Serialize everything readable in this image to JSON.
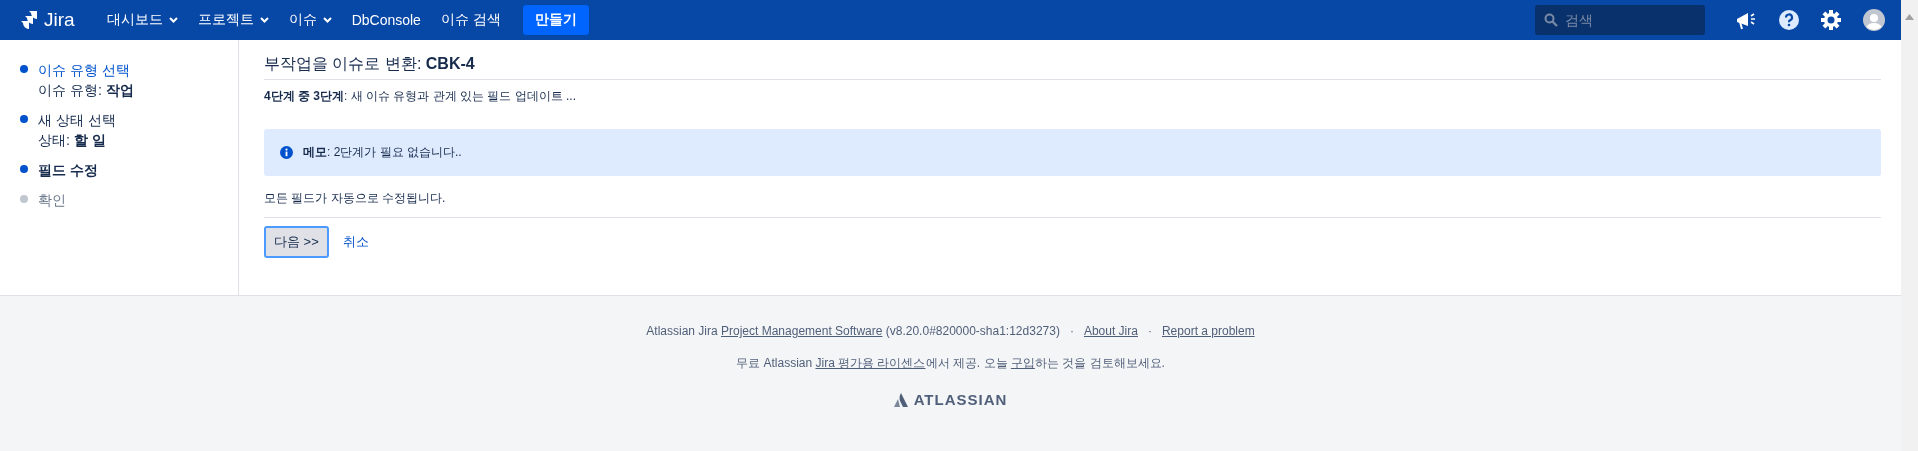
{
  "header": {
    "logo": "Jira",
    "nav": [
      {
        "label": "대시보드",
        "dropdown": true
      },
      {
        "label": "프로젝트",
        "dropdown": true
      },
      {
        "label": "이슈",
        "dropdown": true
      },
      {
        "label": "DbConsole",
        "dropdown": false
      },
      {
        "label": "이슈 검색",
        "dropdown": false
      }
    ],
    "create_button": "만들기",
    "search": {
      "placeholder": "검색"
    }
  },
  "steps": [
    {
      "label": "이슈 유형 선택",
      "done": true,
      "link": true,
      "current": false,
      "detail": "이슈 유형: **작업**"
    },
    {
      "label": "새 상태 선택",
      "done": true,
      "link": false,
      "current": false,
      "detail": "상태: **할 일**"
    },
    {
      "label": "필드 수정",
      "done": true,
      "link": false,
      "current": true
    },
    {
      "label": "확인",
      "done": false,
      "link": false,
      "current": false
    }
  ],
  "page_title": "부작업을 이슈로 변환: **CBK-4**",
  "step_info": "**4단계 중 3단계**: 새 이슈 유형과 관계 있는 필드 업데이트 ...",
  "note": "**메모**: 2단계가 필요 없습니다..",
  "message": "모든 필드가 자동으로 수정됩니다.",
  "buttons": {
    "next": "다음 >>",
    "cancel": "취소"
  },
  "footer": {
    "lines": [
      [
        {
          "kind": "text",
          "text": "Atlassian Jira "
        },
        {
          "kind": "link",
          "text": "Project Management Software"
        },
        {
          "kind": "text",
          "text": " (v8.20.0#820000-sha1:12d3273)"
        },
        {
          "kind": "sep",
          "text": "·"
        },
        {
          "kind": "link",
          "text": "About Jira"
        },
        {
          "kind": "sep",
          "text": "·"
        },
        {
          "kind": "link",
          "text": "Report a problem"
        }
      ],
      [
        {
          "kind": "text",
          "text": "무료 Atlassian "
        },
        {
          "kind": "link",
          "text": "Jira 평가용 라이센스"
        },
        {
          "kind": "text",
          "text": "에서 제공. 오늘 "
        },
        {
          "kind": "link",
          "text": "구입"
        },
        {
          "kind": "text",
          "text": "하는 것을 검토해보세요."
        }
      ]
    ],
    "brand": "ATLASSIAN"
  }
}
